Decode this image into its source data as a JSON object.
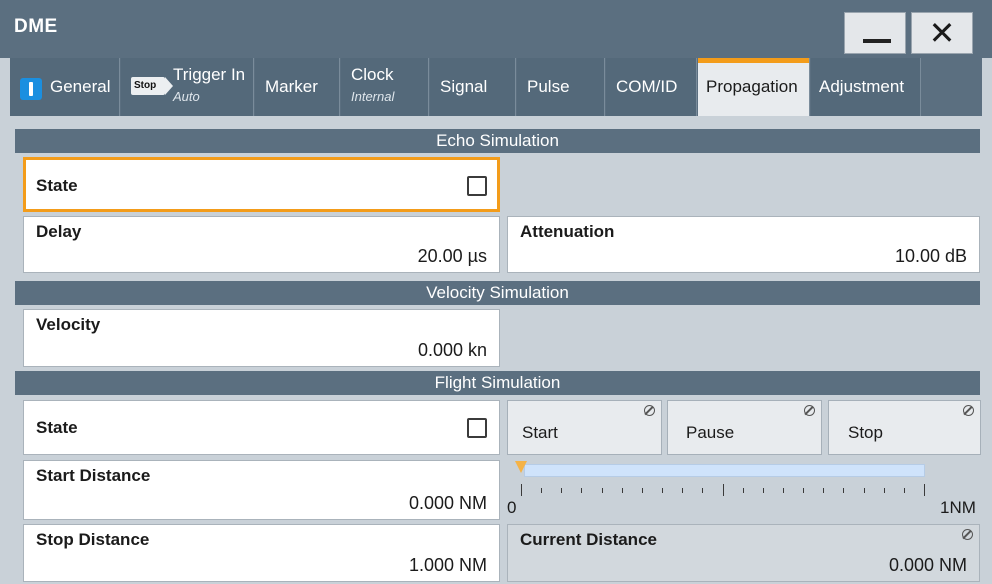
{
  "window": {
    "title": "DME",
    "minimize_icon": "minimize-icon",
    "close_icon": "close-icon",
    "close_glyph": "✕"
  },
  "tabs": [
    {
      "label": "General",
      "sub": "",
      "icon": "info-icon"
    },
    {
      "label": "Trigger In",
      "sub": "Auto",
      "icon": "stop-icon",
      "icon_text": "Stop"
    },
    {
      "label": "Marker",
      "sub": ""
    },
    {
      "label": "Clock",
      "sub": "Internal"
    },
    {
      "label": "Signal",
      "sub": ""
    },
    {
      "label": "Pulse",
      "sub": ""
    },
    {
      "label": "COM/ID",
      "sub": ""
    },
    {
      "label": "Propagation",
      "sub": "",
      "active": true
    },
    {
      "label": "Adjustment",
      "sub": ""
    }
  ],
  "echo": {
    "section_title": "Echo Simulation",
    "state_label": "State",
    "state_checked": false,
    "delay_label": "Delay",
    "delay_value": "20.00 µs",
    "attenuation_label": "Attenuation",
    "attenuation_value": "10.00 dB"
  },
  "velocity": {
    "section_title": "Velocity Simulation",
    "velocity_label": "Velocity",
    "velocity_value": "0.000 kn"
  },
  "flight": {
    "section_title": "Flight Simulation",
    "state_label": "State",
    "state_checked": false,
    "start_button": "Start",
    "pause_button": "Pause",
    "stop_button": "Stop",
    "start_distance_label": "Start Distance",
    "start_distance_value": "0.000 NM",
    "stop_distance_label": "Stop Distance",
    "stop_distance_value": "1.000 NM",
    "current_distance_label": "Current Distance",
    "current_distance_value": "0.000 NM",
    "scale_min": "0",
    "scale_max": "1NM",
    "progress_fraction": 0.0
  },
  "colors": {
    "accent": "#f39c1a",
    "header": "#5b6f80",
    "panel": "#c9d1d8"
  }
}
